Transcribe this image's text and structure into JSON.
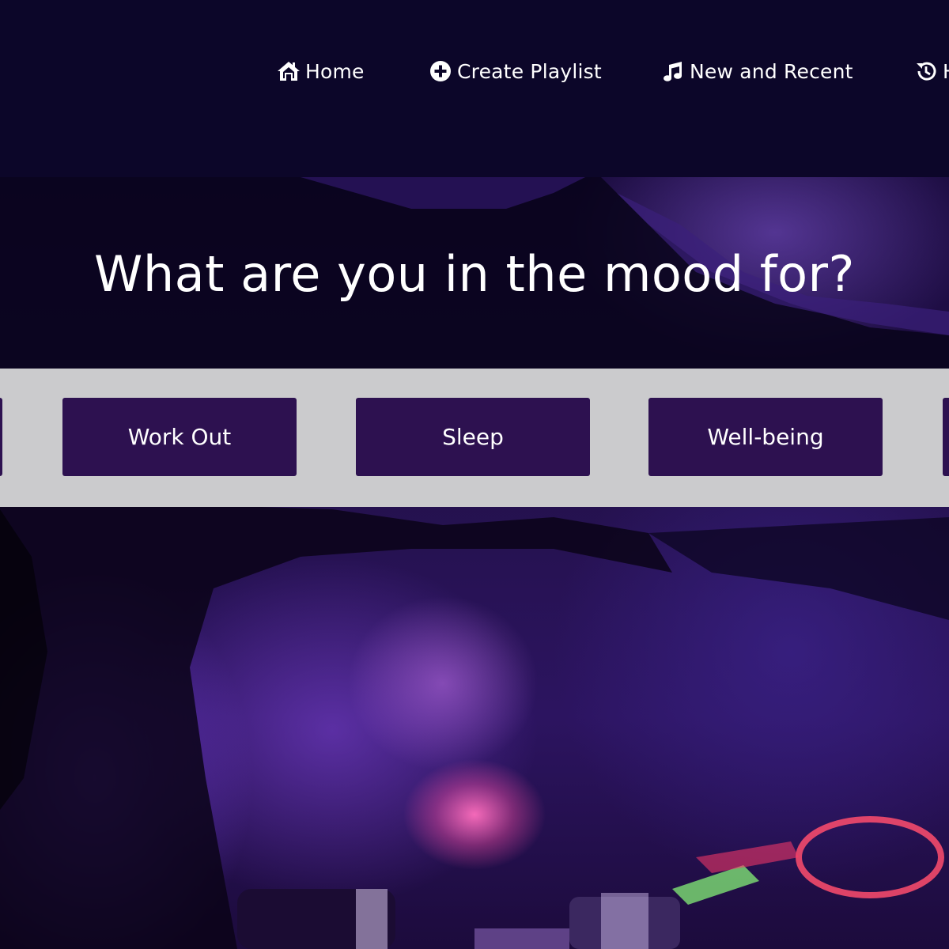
{
  "nav": {
    "items": [
      {
        "label": "Home",
        "icon": "home-icon"
      },
      {
        "label": "Create Playlist",
        "icon": "plus-circle-icon"
      },
      {
        "label": "New and Recent",
        "icon": "music-note-icon"
      },
      {
        "label": "H",
        "icon": "history-icon"
      }
    ]
  },
  "hero": {
    "title": "What are you in the mood for?"
  },
  "moods": {
    "items": [
      {
        "label": ""
      },
      {
        "label": "Work Out"
      },
      {
        "label": "Sleep"
      },
      {
        "label": "Well-being"
      },
      {
        "label": ""
      }
    ]
  },
  "colors": {
    "header_bg": "#0c0629",
    "mood_strip_bg": "#cbcbcd",
    "mood_button_bg": "#2d1150",
    "text": "#ffffff"
  }
}
